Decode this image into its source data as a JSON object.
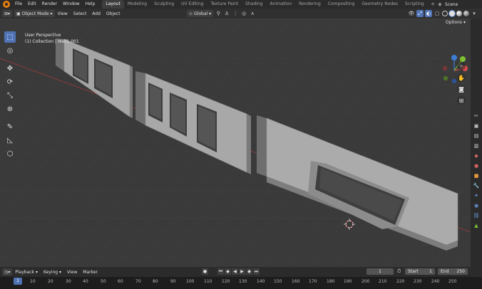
{
  "menu": {
    "items": [
      "File",
      "Edit",
      "Render",
      "Window",
      "Help"
    ]
  },
  "workspaces": {
    "tabs": [
      "Layout",
      "Modeling",
      "Sculpting",
      "UV Editing",
      "Texture Paint",
      "Shading",
      "Animation",
      "Rendering",
      "Compositing",
      "Geometry Nodes",
      "Scripting"
    ],
    "active": "Layout"
  },
  "scene": {
    "name": "Scene"
  },
  "viewport_header": {
    "mode": "Object Mode",
    "menus": [
      "View",
      "Select",
      "Add",
      "Object"
    ],
    "orientation": "Global"
  },
  "viewport": {
    "view_name": "User Perspective",
    "collection_info": "(1) Collection | Wall1.001",
    "options_label": "Options"
  },
  "timeline": {
    "menus": [
      "Playback",
      "Keying",
      "View",
      "Marker"
    ],
    "current_frame": "1",
    "start_label": "Start",
    "start_value": "1",
    "end_label": "End",
    "end_value": "250",
    "ruler_labels": [
      "1",
      "10",
      "20",
      "30",
      "40",
      "50",
      "60",
      "70",
      "80",
      "90",
      "100",
      "110",
      "120",
      "130",
      "140",
      "150",
      "160",
      "170",
      "180",
      "190",
      "200",
      "210",
      "220",
      "230",
      "240",
      "250"
    ]
  },
  "colors": {
    "accent": "#4f73b5",
    "blender_orange": "#e87d0d",
    "axis_x": "#e04a4a",
    "axis_y": "#7ec232",
    "axis_z": "#3e7cd6"
  },
  "icons": {
    "toolbar": [
      "select-box-icon",
      "cursor-icon",
      "move-icon",
      "rotate-icon",
      "scale-icon",
      "transform-icon",
      "annotate-icon",
      "measure-icon",
      "add-cube-icon"
    ],
    "prop_tabs": [
      "tool-icon",
      "render-icon",
      "output-icon",
      "view-layer-icon",
      "scene-icon",
      "world-icon",
      "object-icon",
      "modifier-icon",
      "particles-icon",
      "physics-icon",
      "constraints-icon",
      "data-icon"
    ]
  }
}
